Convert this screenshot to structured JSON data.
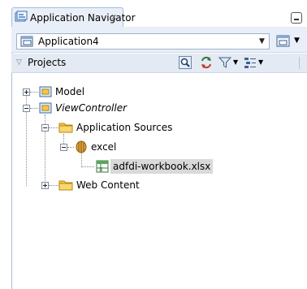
{
  "window": {
    "tab_title": "Application Navigator",
    "tab_close": "x"
  },
  "app_selector": {
    "value": "Application4"
  },
  "projects_header": {
    "label": "Projects",
    "toolbar_icons": [
      "search-icon",
      "sync-icon",
      "filter-icon",
      "sort-icon"
    ]
  },
  "tree": {
    "model": "Model",
    "viewcontroller": "ViewController",
    "application_sources": "Application Sources",
    "excel": "excel",
    "workbook": "adfdi-workbook.xlsx",
    "web_content": "Web Content"
  },
  "colors": {
    "panel_header": "#e9eff8",
    "border": "#a9bcd6",
    "folder": "#f2c94c",
    "selection": "#d9d9d9"
  }
}
